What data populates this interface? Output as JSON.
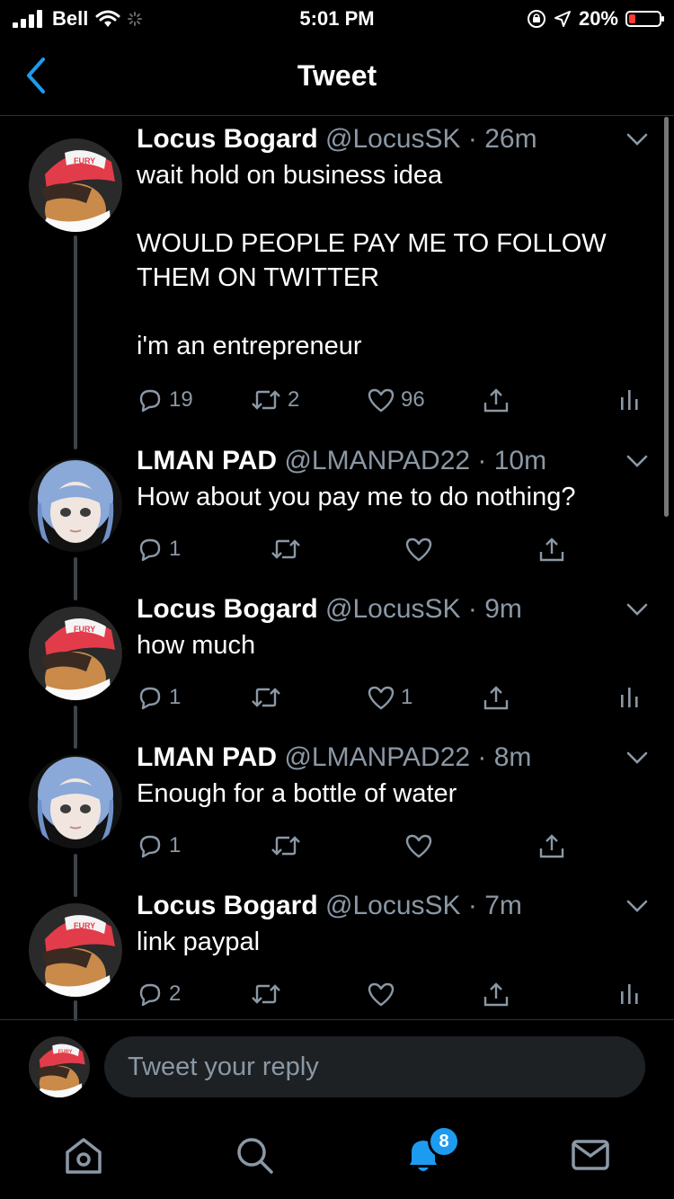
{
  "status": {
    "carrier": "Bell",
    "time": "5:01 PM",
    "battery_pct": "20%",
    "battery_level": 0.2,
    "battery_color": "#ff3b30"
  },
  "nav": {
    "title": "Tweet",
    "back_icon": "chevron-left-icon",
    "accent": "#1d9bf0"
  },
  "tweets": [
    {
      "name": "Locus Bogard",
      "handle": "@LocusSK",
      "time": "26m",
      "text": "wait hold on business idea\n\nWOULD PEOPLE PAY ME TO FOLLOW\nTHEM ON TWITTER\n\ni'm an entrepreneur",
      "replies": "19",
      "retweets": "2",
      "likes": "96"
    },
    {
      "name": "LMAN PAD",
      "handle": "@LMANPAD22",
      "time": "10m",
      "text": "How about you pay me to do nothing?",
      "replies": "1",
      "retweets": "",
      "likes": ""
    },
    {
      "name": "Locus Bogard",
      "handle": "@LocusSK",
      "time": "9m",
      "text": "how much",
      "replies": "1",
      "retweets": "",
      "likes": "1"
    },
    {
      "name": "LMAN PAD",
      "handle": "@LMANPAD22",
      "time": "8m",
      "text": "Enough for a bottle of water",
      "replies": "1",
      "retweets": "",
      "likes": ""
    },
    {
      "name": "Locus Bogard",
      "handle": "@LocusSK",
      "time": "7m",
      "text": "link paypal",
      "replies": "2",
      "retweets": "",
      "likes": ""
    }
  ],
  "reply": {
    "placeholder": "Tweet your reply"
  },
  "tabs": {
    "items": [
      "home-icon",
      "search-icon",
      "notifications-icon",
      "messages-icon"
    ],
    "notification_count": "8"
  }
}
